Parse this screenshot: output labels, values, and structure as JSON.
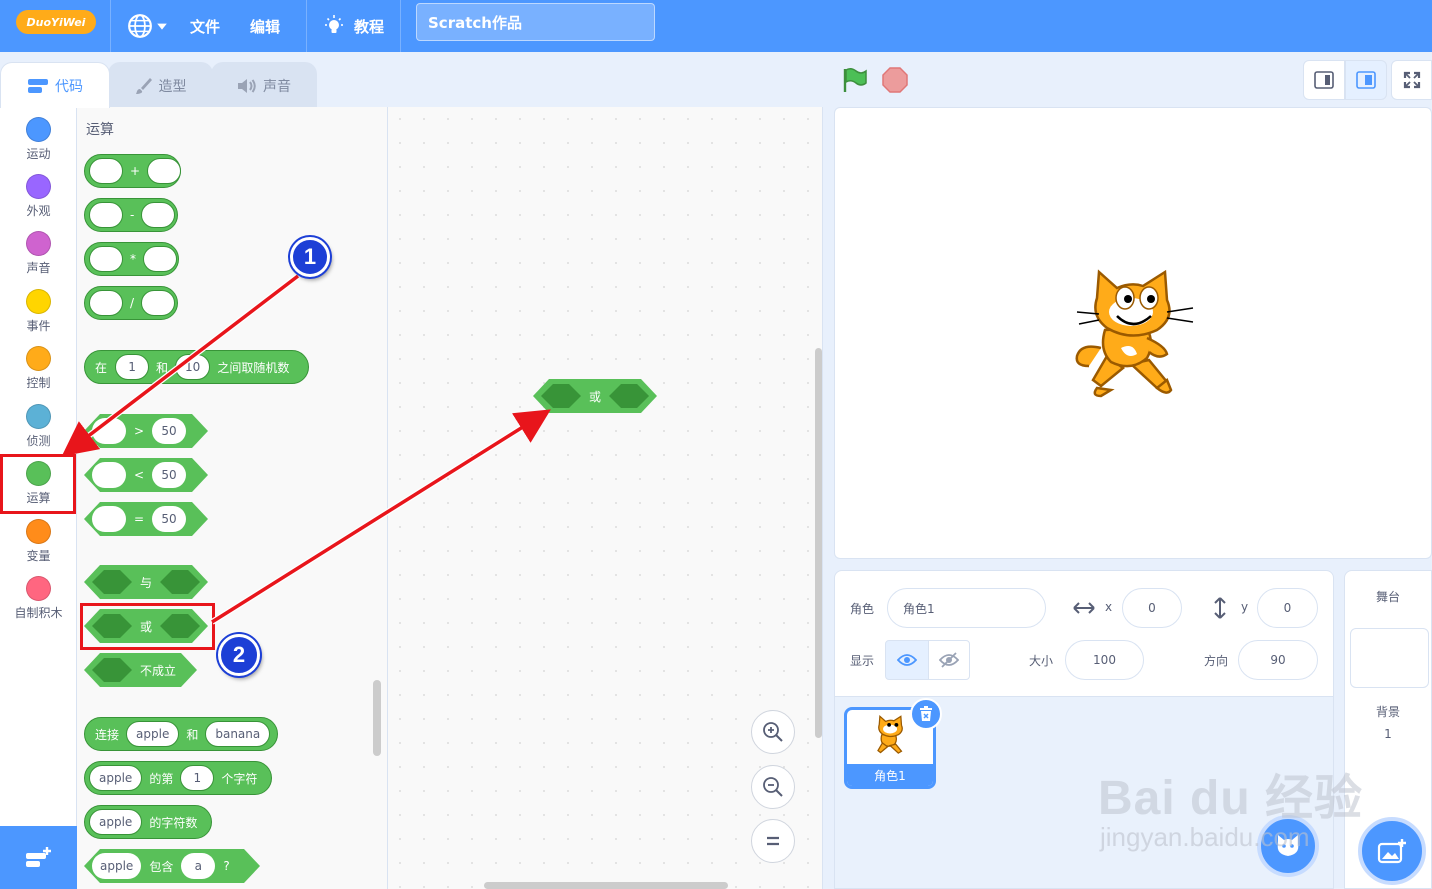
{
  "menubar": {
    "logo_text": "DuoYiWei",
    "file_label": "文件",
    "edit_label": "编辑",
    "tutorial_label": "教程",
    "project_title": "Scratch作品"
  },
  "tabs": {
    "code": "代码",
    "costumes": "造型",
    "sounds": "声音"
  },
  "categories": [
    {
      "label": "运动",
      "color": "#4c97ff"
    },
    {
      "label": "外观",
      "color": "#9966ff"
    },
    {
      "label": "声音",
      "color": "#cf63cf"
    },
    {
      "label": "事件",
      "color": "#ffd500"
    },
    {
      "label": "控制",
      "color": "#ffab19"
    },
    {
      "label": "侦测",
      "color": "#5cb1d6"
    },
    {
      "label": "运算",
      "color": "#59c059"
    },
    {
      "label": "变量",
      "color": "#ff8c1a"
    },
    {
      "label": "自制积木",
      "color": "#ff6680"
    }
  ],
  "palette": {
    "section_title": "运算",
    "add_op": "+",
    "sub_op": "-",
    "mul_op": "*",
    "div_op": "/",
    "random": {
      "t1": "在",
      "v1": "1",
      "t2": "和",
      "v2": "10",
      "t3": "之间取随机数"
    },
    "gt": {
      "op": ">",
      "v": "50"
    },
    "lt": {
      "op": "<",
      "v": "50"
    },
    "eq": {
      "op": "=",
      "v": "50"
    },
    "and": "与",
    "or": "或",
    "not": "不成立",
    "join": {
      "t1": "连接",
      "v1": "apple",
      "t2": "和",
      "v2": "banana"
    },
    "letter": {
      "v1": "apple",
      "t1": "的第",
      "v2": "1",
      "t2": "个字符"
    },
    "length": {
      "v1": "apple",
      "t1": "的字符数"
    },
    "contains": {
      "v1": "apple",
      "t1": "包含",
      "v2": "a",
      "t2": "?"
    }
  },
  "script_block": {
    "label": "或"
  },
  "annotations": {
    "marker1": "1",
    "marker2": "2"
  },
  "sprite_info": {
    "sprite_label": "角色",
    "sprite_name": "角色1",
    "x_label": "x",
    "x_value": "0",
    "y_label": "y",
    "y_value": "0",
    "show_label": "显示",
    "size_label": "大小",
    "size_value": "100",
    "direction_label": "方向",
    "direction_value": "90"
  },
  "sprite_list": [
    {
      "name": "角色1"
    }
  ],
  "stage_panel": {
    "title": "舞台",
    "backdrop_label": "背景",
    "backdrop_count": "1"
  },
  "watermark": {
    "line1": "Bai du 经验",
    "line2": "jingyan.baidu.com"
  },
  "colors": {
    "menubar": "#4c97ff",
    "operators": "#59c059",
    "operators_dark": "#389438",
    "highlight": "#e8151b",
    "marker": "#1d3fd6"
  }
}
